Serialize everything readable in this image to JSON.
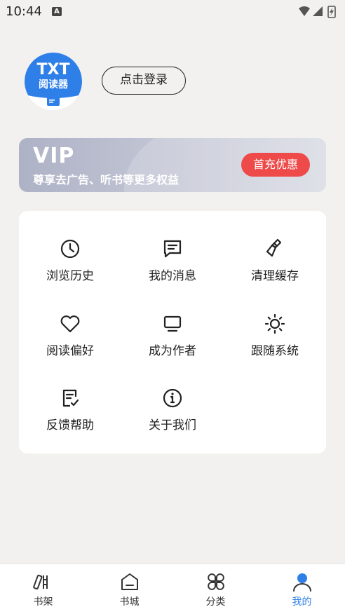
{
  "status_bar": {
    "time": "10:44",
    "keyboard_indicator": "A"
  },
  "profile": {
    "avatar_line1": "TXT",
    "avatar_line2": "阅读器",
    "login_label": "点击登录"
  },
  "vip": {
    "title": "VIP",
    "subtitle": "尊享去广告、听书等更多权益",
    "button_label": "首充优惠"
  },
  "menu": {
    "items": [
      {
        "label": "浏览历史",
        "icon": "clock-icon"
      },
      {
        "label": "我的消息",
        "icon": "message-icon"
      },
      {
        "label": "清理缓存",
        "icon": "broom-icon"
      },
      {
        "label": "阅读偏好",
        "icon": "heart-icon"
      },
      {
        "label": "成为作者",
        "icon": "monitor-icon"
      },
      {
        "label": "跟随系统",
        "icon": "sun-icon"
      },
      {
        "label": "反馈帮助",
        "icon": "feedback-icon"
      },
      {
        "label": "关于我们",
        "icon": "info-icon"
      }
    ]
  },
  "bottom_nav": {
    "items": [
      {
        "label": "书架",
        "icon": "bookshelf-icon",
        "active": false
      },
      {
        "label": "书城",
        "icon": "bookstore-icon",
        "active": false
      },
      {
        "label": "分类",
        "icon": "category-icon",
        "active": false
      },
      {
        "label": "我的",
        "icon": "profile-icon",
        "active": true
      }
    ]
  },
  "colors": {
    "accent": "#2f7fe8",
    "vip_button": "#ee4a4a",
    "avatar_blue": "#2f7fe8"
  }
}
